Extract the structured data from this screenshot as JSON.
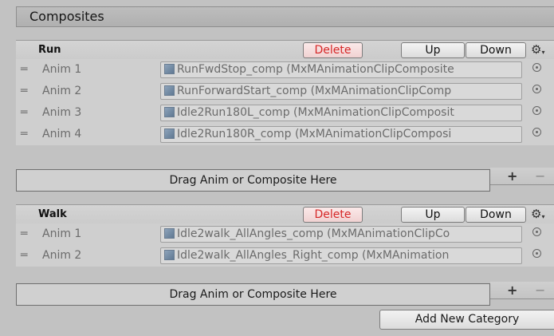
{
  "panel": {
    "title": "Composites"
  },
  "categories": [
    {
      "name": "Run",
      "delete_label": "Delete",
      "up_label": "Up",
      "down_label": "Down",
      "gear_icon": "gear-icon",
      "anims": [
        {
          "label": "Anim 1",
          "value": "RunFwdStop_comp (MxMAnimationClipComposite"
        },
        {
          "label": "Anim 2",
          "value": "RunForwardStart_comp (MxMAnimationClipComp"
        },
        {
          "label": "Anim 3",
          "value": "Idle2Run180L_comp (MxMAnimationClipComposit"
        },
        {
          "label": "Anim 4",
          "value": "Idle2Run180R_comp (MxMAnimationClipComposi"
        }
      ],
      "drop_label": "Drag Anim or Composite Here",
      "plus_label": "+",
      "minus_label": "−"
    },
    {
      "name": "Walk",
      "delete_label": "Delete",
      "up_label": "Up",
      "down_label": "Down",
      "gear_icon": "gear-icon",
      "anims": [
        {
          "label": "Anim 1",
          "value": "Idle2walk_AllAngles_comp (MxMAnimationClipCo"
        },
        {
          "label": "Anim 2",
          "value": "Idle2walk_AllAngles_Right_comp (MxMAnimation"
        }
      ],
      "drop_label": "Drag Anim or Composite Here",
      "plus_label": "+",
      "minus_label": "−"
    }
  ],
  "add_category_label": "Add New Category",
  "colors": {
    "delete_text": "#d62828",
    "background": "#c2c2c2"
  }
}
